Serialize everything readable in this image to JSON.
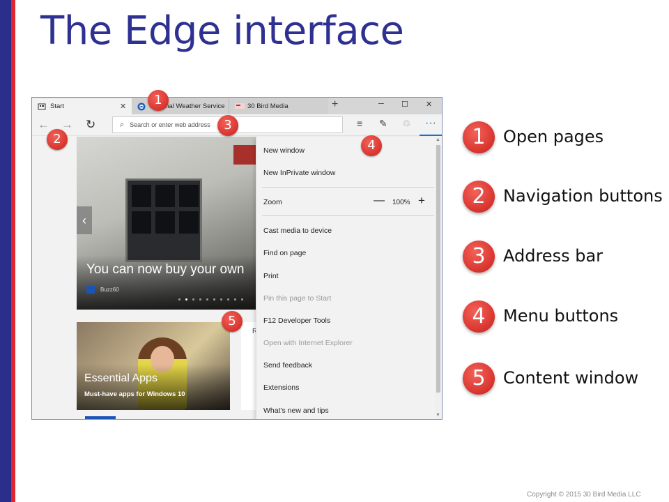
{
  "slide": {
    "title": "The Edge interface",
    "copyright": "Copyright © 2015 30 Bird Media LLC"
  },
  "browser": {
    "tabs": [
      {
        "label": "Start",
        "icon": "start-page-icon"
      },
      {
        "label": "National Weather Service",
        "icon": "weather-service-icon"
      },
      {
        "label": "30 Bird Media",
        "icon": "site-favicon-icon"
      }
    ],
    "tab_close": "✕",
    "new_tab": "+",
    "window_controls": {
      "minimize": "─",
      "maximize": "☐",
      "close": "✕"
    },
    "nav": {
      "back": "←",
      "forward": "→",
      "refresh": "↻"
    },
    "address_placeholder": "Search or enter web address",
    "toolbar": {
      "hub": "≡",
      "note": "✎",
      "share": "♲",
      "more": "···"
    },
    "hero": {
      "caption": "You can now buy your own",
      "source": "Buzz60",
      "prev": "‹",
      "slide_index": 2,
      "slide_count": 10
    },
    "apps_card": {
      "title": "Essential Apps",
      "subtitle": "Must-have apps for Windows 10"
    },
    "side_letter": "R",
    "menu": {
      "items": [
        {
          "label": "New window",
          "enabled": true
        },
        {
          "label": "New InPrivate window",
          "enabled": true
        },
        {
          "label": "Zoom",
          "enabled": true
        },
        {
          "label": "Cast media to device",
          "enabled": true
        },
        {
          "label": "Find on page",
          "enabled": true
        },
        {
          "label": "Print",
          "enabled": true
        },
        {
          "label": "Pin this page to Start",
          "enabled": false
        },
        {
          "label": "F12 Developer Tools",
          "enabled": true
        },
        {
          "label": "Open with Internet Explorer",
          "enabled": false
        },
        {
          "label": "Send feedback",
          "enabled": true
        },
        {
          "label": "Extensions",
          "enabled": true
        },
        {
          "label": "What's new and tips",
          "enabled": true
        }
      ],
      "zoom_minus": "—",
      "zoom_value": "100%",
      "zoom_plus": "+"
    }
  },
  "callouts": [
    "1",
    "2",
    "3",
    "4",
    "5"
  ],
  "legend": [
    {
      "number": "1",
      "label": "Open pages"
    },
    {
      "number": "2",
      "label": "Navigation buttons"
    },
    {
      "number": "3",
      "label": "Address bar"
    },
    {
      "number": "4",
      "label": "Menu buttons"
    },
    {
      "number": "5",
      "label": "Content window"
    }
  ],
  "colors": {
    "title": "#2e3192",
    "accent_blue": "#2b2f8c",
    "accent_red": "#e0262e",
    "badge": "#dc3a33",
    "edge_blue": "#1a73c9"
  }
}
